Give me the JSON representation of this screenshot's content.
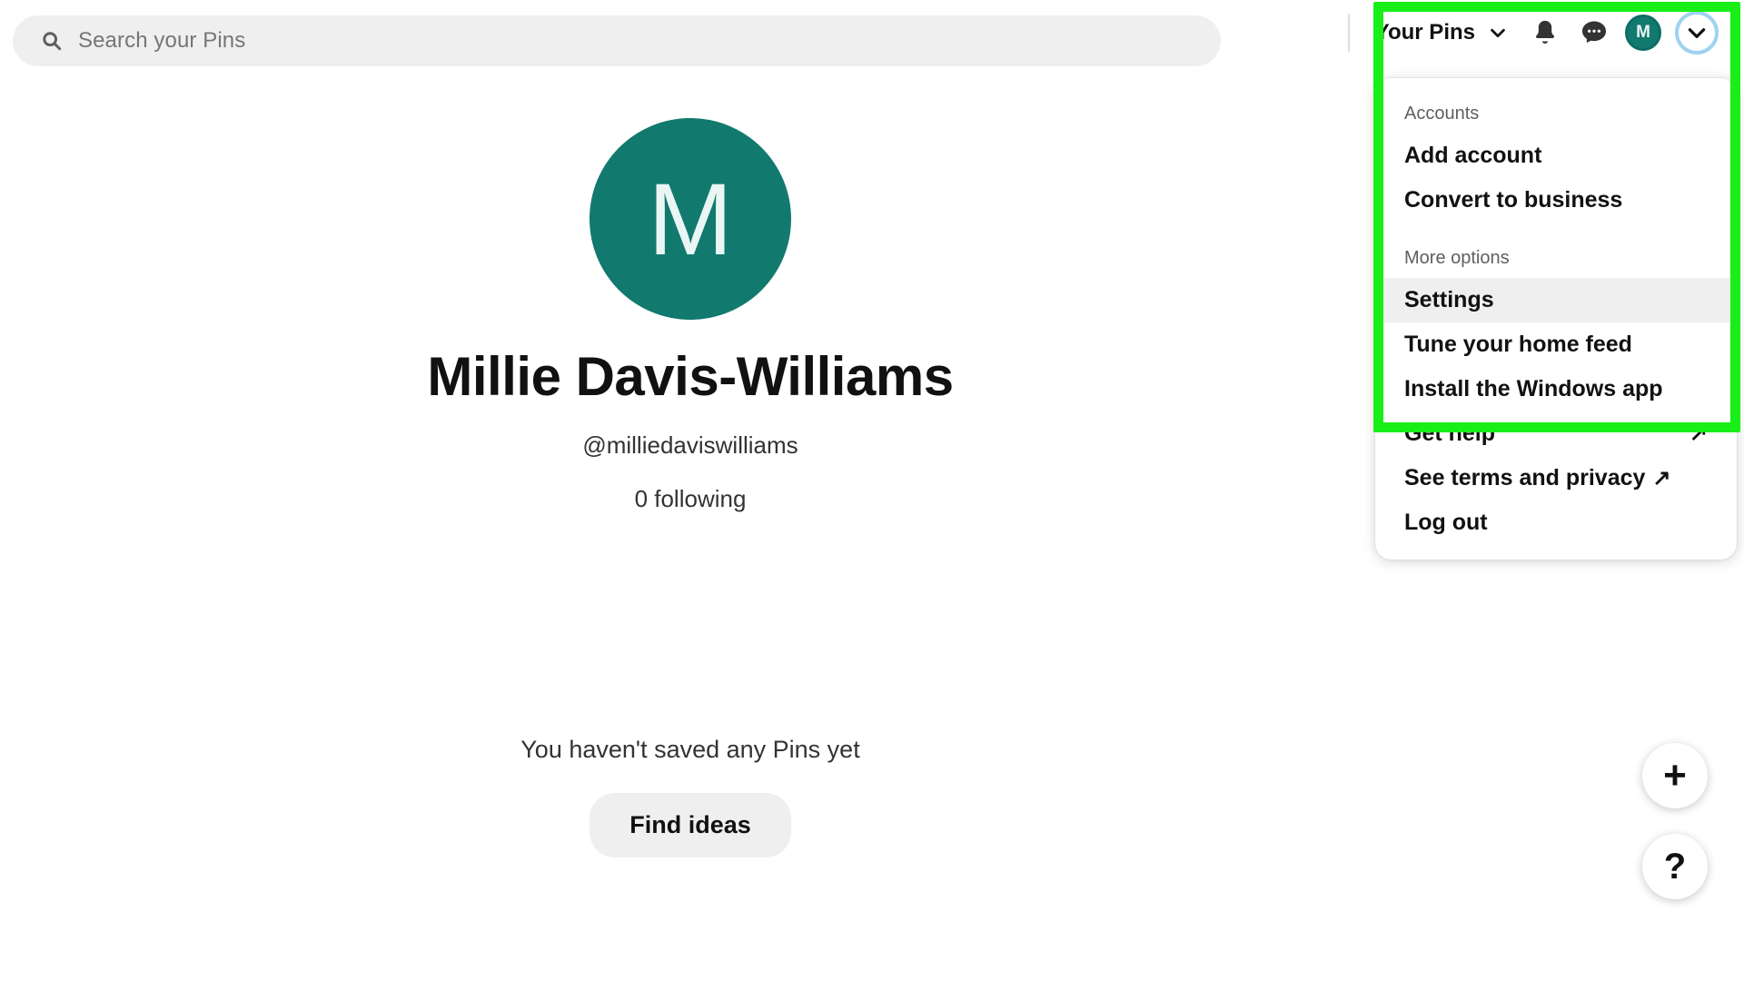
{
  "app": {
    "name": "Pinterest",
    "accent_teal": "#12796f",
    "annotation_color": "#18ef18"
  },
  "header": {
    "search": {
      "placeholder": "Search your Pins",
      "value": "",
      "icon": "search-icon"
    },
    "your_pins_label": "Your Pins",
    "chevron_icon": "chevron-down-icon",
    "icons": [
      {
        "name": "bell-icon",
        "label": "Notifications"
      },
      {
        "name": "chat-icon",
        "label": "Messages"
      }
    ],
    "avatar": {
      "initial": "M",
      "name": "avatar"
    },
    "account_chevron": {
      "name": "chevron-down-icon",
      "focus_ring_color": "#9fd2f2"
    }
  },
  "profile": {
    "avatar_initial": "M",
    "name": "Millie Davis-Williams",
    "handle": "@milliedaviswilliams",
    "following": "0 following"
  },
  "empty_state": {
    "message": "You haven't saved any Pins yet",
    "cta_label": "Find ideas"
  },
  "floating_buttons": [
    {
      "name": "create-button",
      "glyph": "+"
    },
    {
      "name": "help-button",
      "glyph": "?"
    }
  ],
  "account_menu": {
    "sections": [
      {
        "label": "Accounts",
        "items": [
          {
            "label": "Add account",
            "external": false,
            "highlighted": false
          },
          {
            "label": "Convert to business",
            "external": false,
            "highlighted": false
          }
        ]
      },
      {
        "label": "More options",
        "items": [
          {
            "label": "Settings",
            "external": false,
            "highlighted": true
          },
          {
            "label": "Tune your home feed",
            "external": false,
            "highlighted": false
          },
          {
            "label": "Install the Windows app",
            "external": false,
            "highlighted": false
          },
          {
            "label": "Get help",
            "external": true,
            "highlighted": false
          },
          {
            "label": "See terms and privacy",
            "external": true,
            "highlighted": false
          },
          {
            "label": "Log out",
            "external": false,
            "highlighted": false
          }
        ]
      }
    ],
    "external_arrow_glyph": "↗"
  }
}
